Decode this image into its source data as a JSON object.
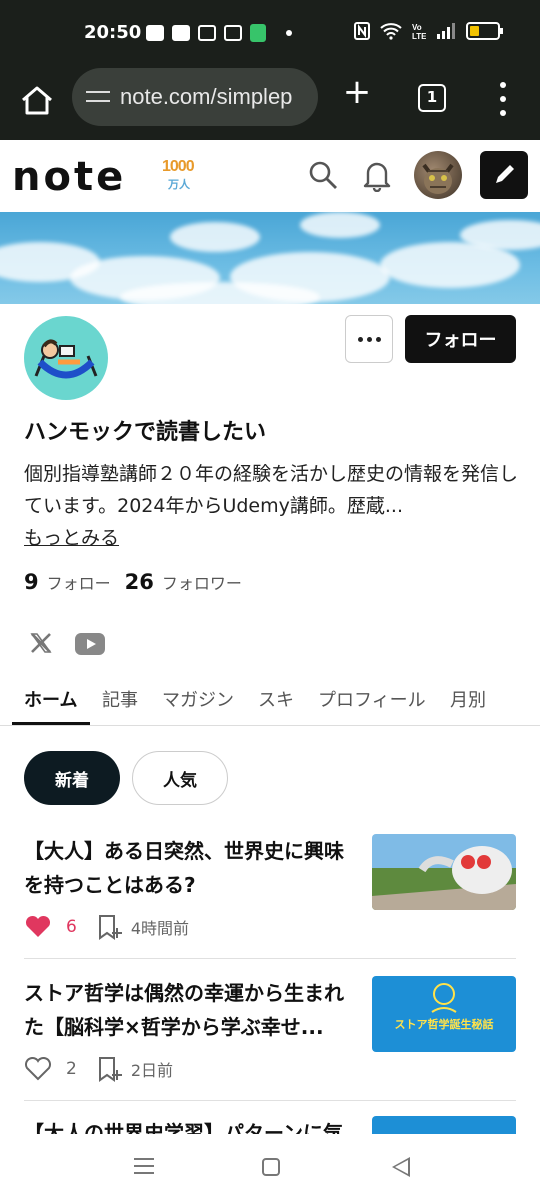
{
  "status_bar": {
    "time": "20:50",
    "icons_left": [
      "youtube-icon",
      "mail-icon",
      "news-icon",
      "my-app-icon",
      "battery-saver-icon"
    ],
    "icons_right": [
      "nfc-icon",
      "wifi-icon",
      "volte-icon",
      "signal-icon",
      "battery-icon"
    ],
    "battery_level": 0.35,
    "battery_color": "#f2c200"
  },
  "browser": {
    "url": "note.com/simplep",
    "tab_count": "1"
  },
  "note_header": {
    "logo_text": "note",
    "badge_number": "1000",
    "badge_text": "万人"
  },
  "profile": {
    "name": "ハンモックで読書したい",
    "bio": "個別指導塾講師２０年の経験を活かし歴史の情報を発信しています。2024年からUdemy講師。歴蔵...",
    "more_label": "もっとみる",
    "follow_button": "フォロー",
    "following_count": "9",
    "following_label": "フォロー",
    "followers_count": "26",
    "followers_label": "フォロワー"
  },
  "tabs": [
    "ホーム",
    "記事",
    "マガジン",
    "スキ",
    "プロフィール",
    "月別"
  ],
  "active_tab": "ホーム",
  "filters": {
    "new_label": "新着",
    "popular_label": "人気"
  },
  "articles": [
    {
      "title": "【大人】ある日突然、世界史に興味を持つことはある?",
      "likes": "6",
      "liked": true,
      "time": "4時間前"
    },
    {
      "title": "ストア哲学は偶然の幸運から生まれた【脳科学×哲学から学ぶ幸せ...",
      "likes": "2",
      "liked": false,
      "time": "2日前",
      "thumb_text": "ストア哲学誕生秘話"
    },
    {
      "title": "【大人の世界史学習】パターンに気",
      "likes": "",
      "liked": false,
      "time": ""
    }
  ],
  "colors": {
    "dark": "#111111",
    "like_red": "#e0375f",
    "sky_blue": "#4aa6d6",
    "avatar_teal": "#6ad6cf",
    "thumb_blue": "#1d8fd6"
  }
}
